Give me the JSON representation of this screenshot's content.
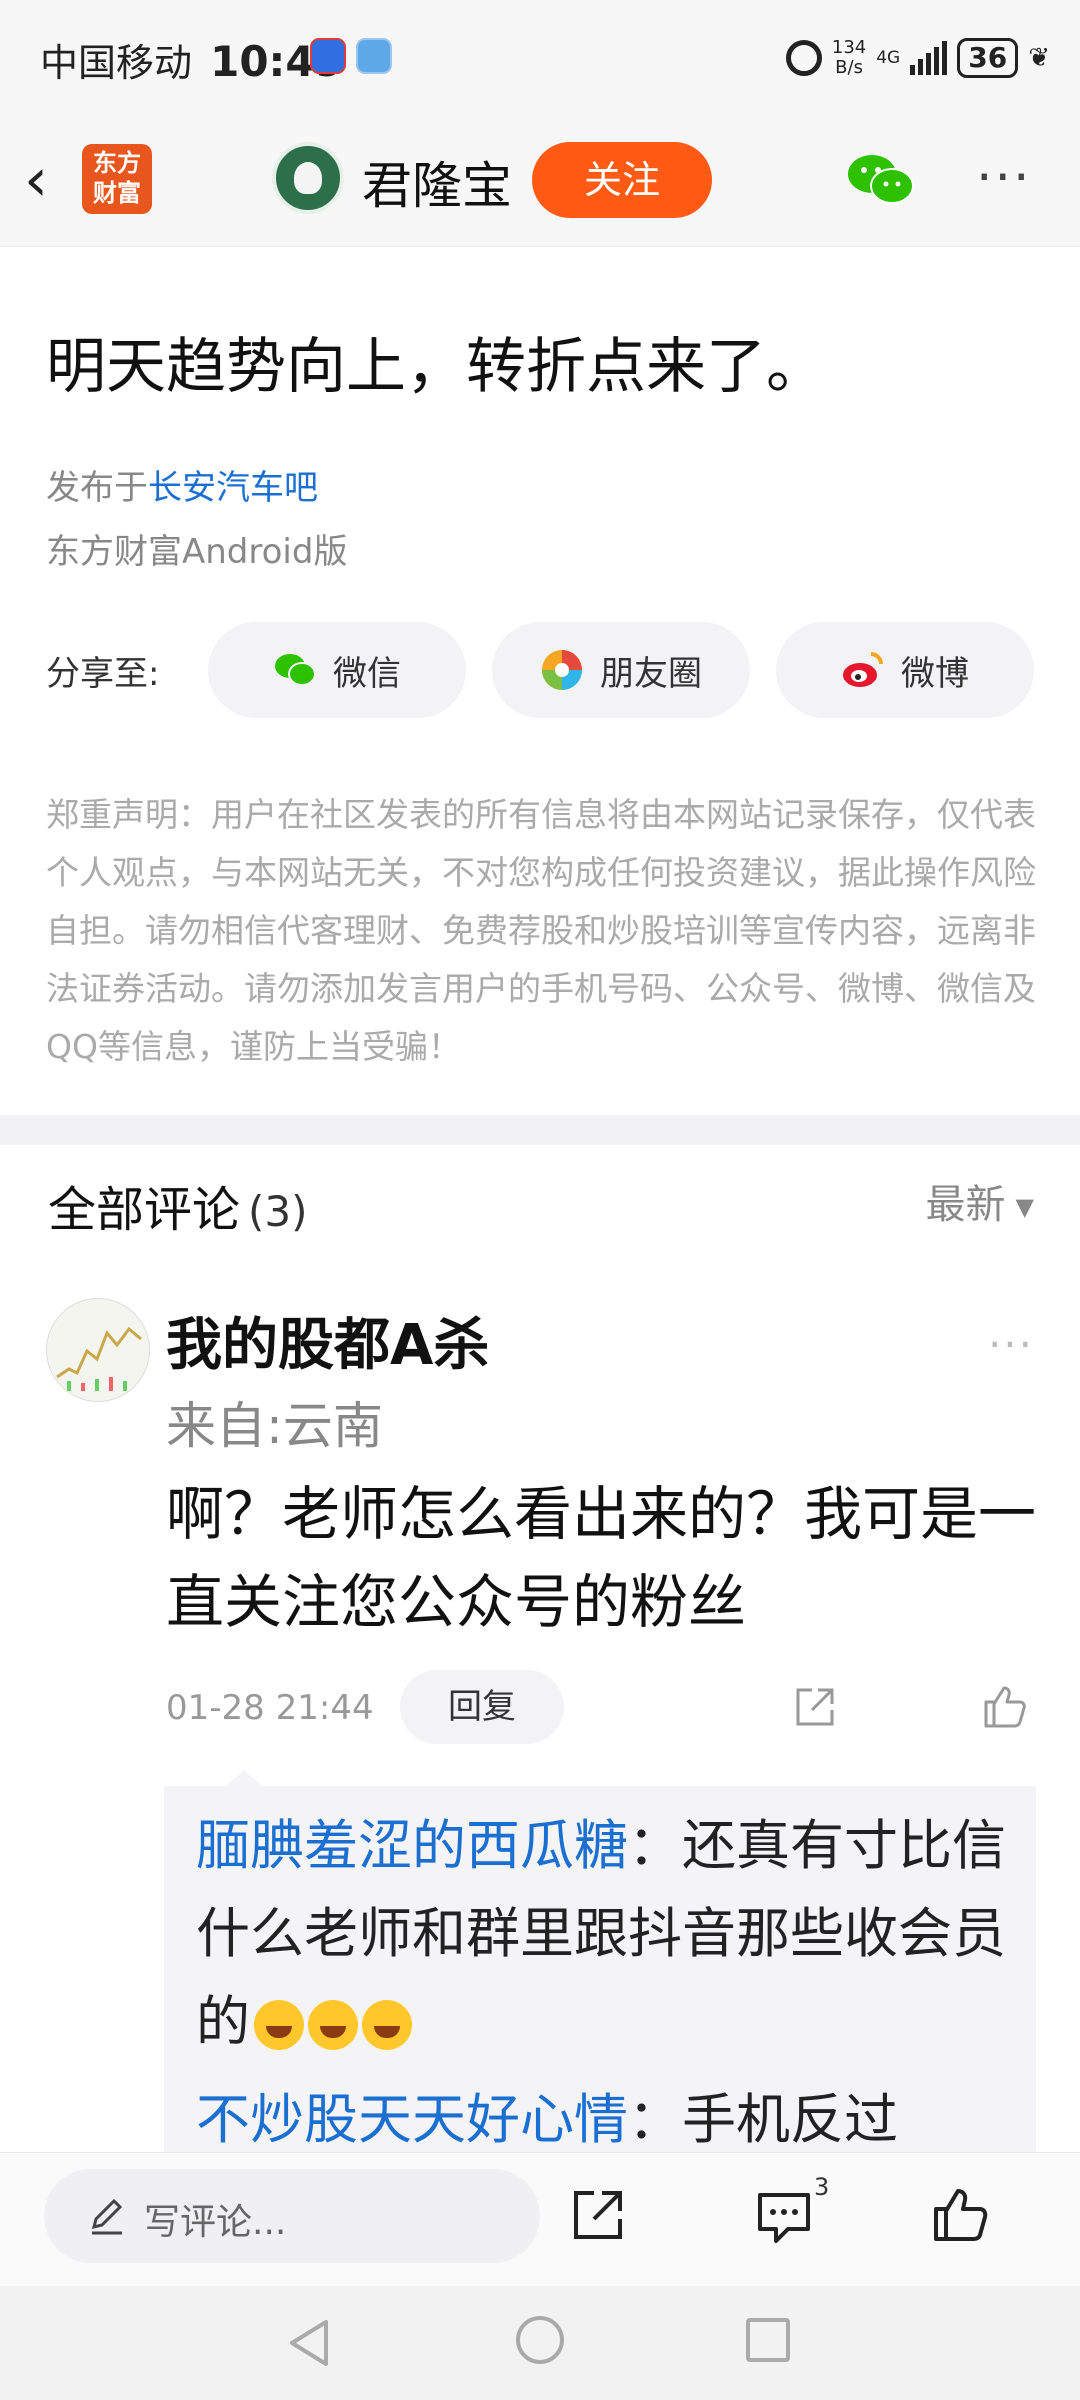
{
  "status_bar": {
    "carrier": "中国移动",
    "time": "10:49",
    "net_rate_top": "134",
    "net_rate_bottom": "B/s",
    "network": "4G",
    "battery": "36"
  },
  "nav": {
    "logo_line1": "东方",
    "logo_line2": "财富",
    "author": "君隆宝",
    "follow_label": "关注"
  },
  "post": {
    "title": "明天趋势向上，转折点来了。",
    "published_prefix": "发布于",
    "forum_link": "长安汽车吧",
    "client": "东方财富Android版"
  },
  "share": {
    "label": "分享至:",
    "options": [
      {
        "label": "微信",
        "icon": "wechat-icon",
        "color": "#2dc100"
      },
      {
        "label": "朋友圈",
        "icon": "moments-icon",
        "color": "#f5a623"
      },
      {
        "label": "微博",
        "icon": "weibo-icon",
        "color": "#e6162d"
      }
    ]
  },
  "disclaimer": "郑重声明：用户在社区发表的所有信息将由本网站记录保存，仅代表个人观点，与本网站无关，不对您构成任何投资建议，据此操作风险自担。请勿相信代客理财、免费荐股和炒股培训等宣传内容，远离非法证券活动。请勿添加发言用户的手机号码、公众号、微博、微信及QQ等信息，谨防上当受骗！",
  "comments": {
    "title": "全部评论",
    "count": "(3)",
    "sort": "最新",
    "items": [
      {
        "user": "我的股都A杀",
        "location": "来自:云南",
        "body": "啊？老师怎么看出来的？我可是一直关注您公众号的粉丝",
        "time": "01-28 21:44",
        "reply_label": "回复",
        "replies": [
          {
            "name": "腼腆羞涩的西瓜糖",
            "text": "：还真有寸比信什么老师和群里跟抖音那些收会员的"
          },
          {
            "name": "不炒股天天好心情",
            "text": "：手机反过"
          }
        ]
      }
    ]
  },
  "bottom_bar": {
    "input_placeholder": "写评论...",
    "comment_count": "3"
  },
  "colors": {
    "accent": "#ff5a14",
    "link": "#1b6fd1",
    "logo": "#e8561e"
  }
}
